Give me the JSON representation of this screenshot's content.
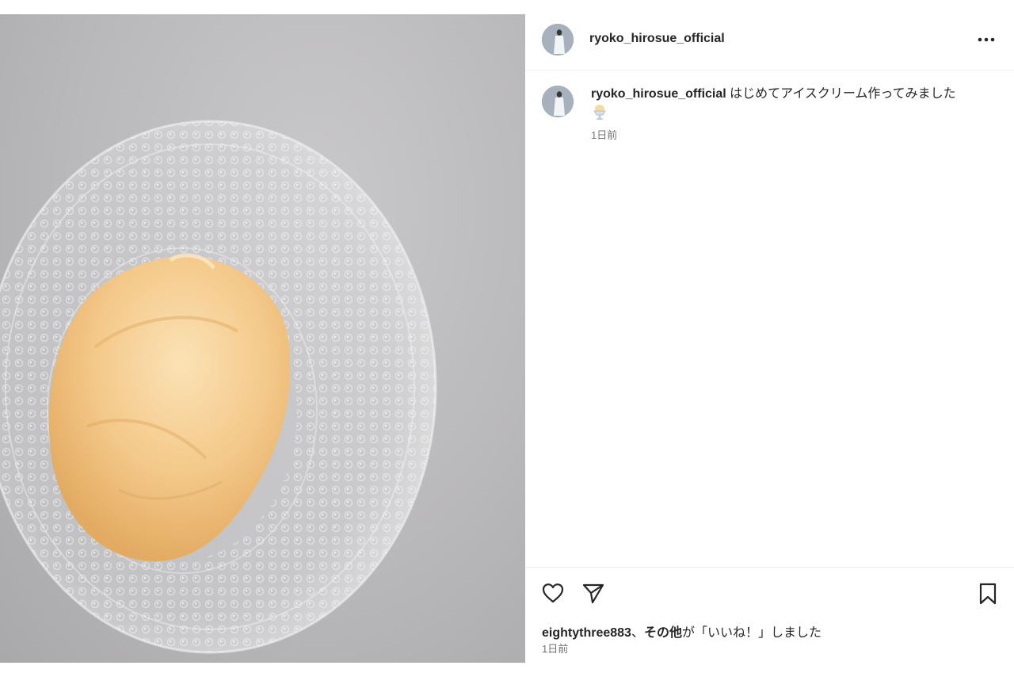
{
  "post": {
    "username": "ryoko_hirosue_official",
    "caption_text": "はじめてアイスクリーム作ってみました",
    "caption_emoji": "ice-cream-sundae-emoji",
    "caption_time": "1日前",
    "likes_user": "eightythree883",
    "likes_sep": "、",
    "likes_others": "その他",
    "likes_suffix": "が「いいね！」しました",
    "post_time": "1日前"
  },
  "icons": {
    "more": "more-options-icon",
    "like": "heart-icon",
    "share": "paper-plane-icon",
    "save": "bookmark-icon"
  },
  "colors": {
    "text": "#262626",
    "secondary": "#737373",
    "divider": "#efefef",
    "ice_cream": "#f4c98a"
  }
}
